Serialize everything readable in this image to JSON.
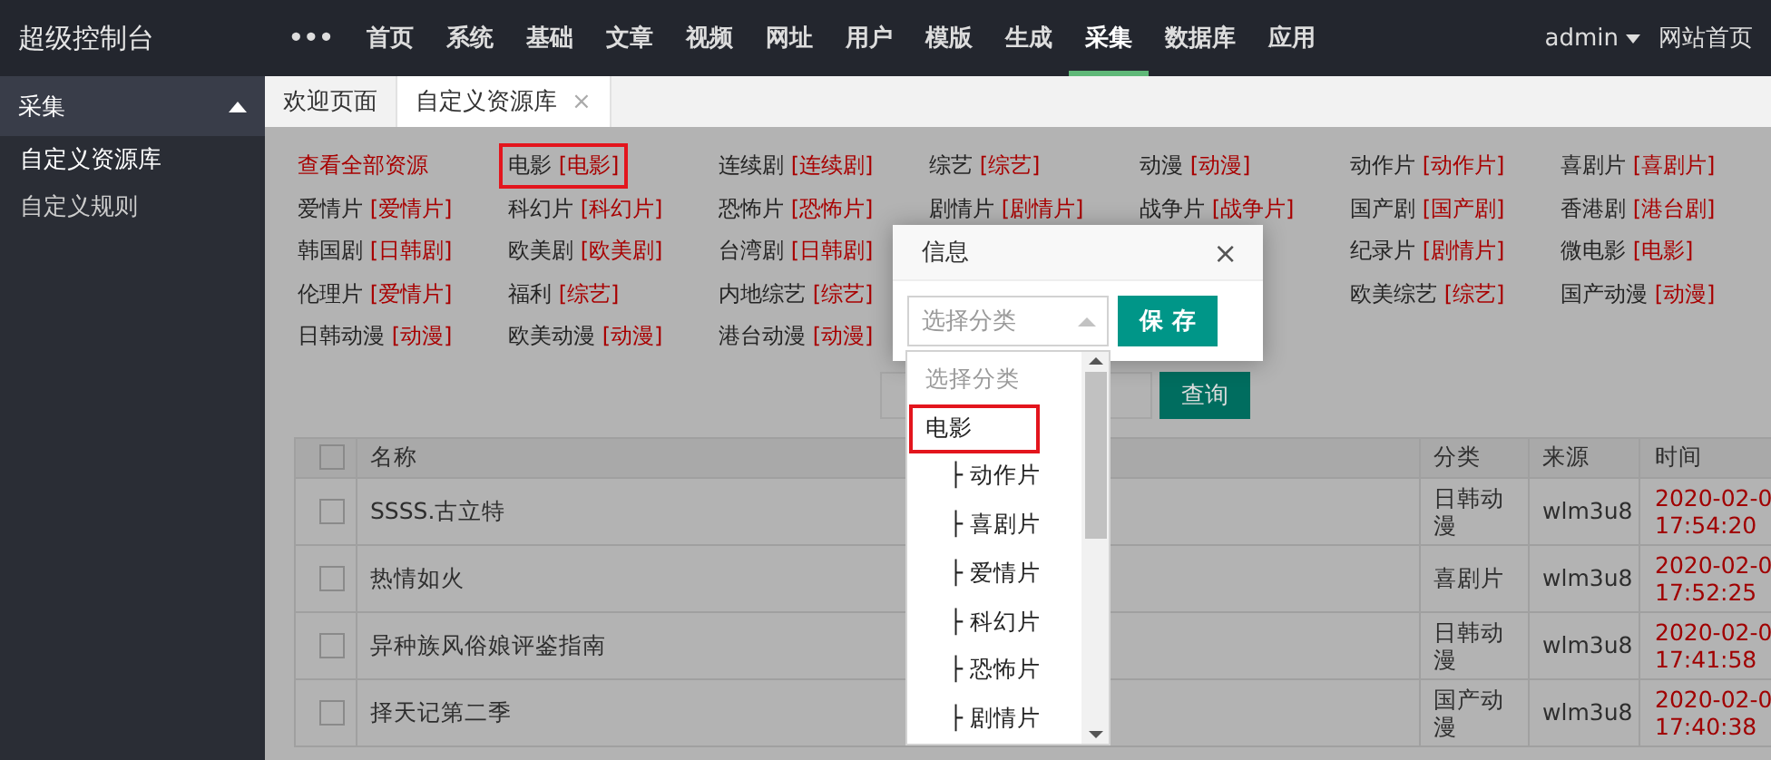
{
  "top_bar": {
    "logo": "超级控制台",
    "nav": [
      {
        "label": "•••",
        "selected": false
      },
      {
        "label": "首页",
        "selected": false
      },
      {
        "label": "系统",
        "selected": false
      },
      {
        "label": "基础",
        "selected": false
      },
      {
        "label": "文章",
        "selected": false
      },
      {
        "label": "视频",
        "selected": false
      },
      {
        "label": "网址",
        "selected": false
      },
      {
        "label": "用户",
        "selected": false
      },
      {
        "label": "模版",
        "selected": false
      },
      {
        "label": "生成",
        "selected": false
      },
      {
        "label": "采集",
        "selected": true
      },
      {
        "label": "数据库",
        "selected": false
      },
      {
        "label": "应用",
        "selected": false
      }
    ],
    "user": "admin",
    "site_link": "网站首页"
  },
  "sidebar": {
    "header": "采集",
    "expanded": true,
    "items": [
      {
        "label": "自定义资源库",
        "selected": true
      },
      {
        "label": "自定义规则",
        "selected": false
      }
    ]
  },
  "tabs": [
    {
      "label": "欢迎页面",
      "selected": false,
      "closable": false
    },
    {
      "label": "自定义资源库",
      "selected": true,
      "closable": true,
      "close": "×"
    }
  ],
  "category_links": [
    {
      "kind": "all",
      "name": "查看全部资源",
      "highlighted": false
    },
    {
      "kind": "mapped",
      "name": "电影",
      "target": "[电影]",
      "highlighted": true
    },
    {
      "kind": "mapped",
      "name": "连续剧",
      "target": "[连续剧]",
      "highlighted": false
    },
    {
      "kind": "mapped",
      "name": "综艺",
      "target": "[综艺]",
      "highlighted": false
    },
    {
      "kind": "mapped",
      "name": "动漫",
      "target": "[动漫]",
      "highlighted": false
    },
    {
      "kind": "mapped",
      "name": "动作片",
      "target": "[动作片]",
      "highlighted": false
    },
    {
      "kind": "mapped",
      "name": "喜剧片",
      "target": "[喜剧片]",
      "highlighted": false
    },
    {
      "kind": "mapped",
      "name": "爱情片",
      "target": "[爱情片]",
      "highlighted": false
    },
    {
      "kind": "mapped",
      "name": "科幻片",
      "target": "[科幻片]",
      "highlighted": false
    },
    {
      "kind": "mapped",
      "name": "恐怖片",
      "target": "[恐怖片]",
      "highlighted": false
    },
    {
      "kind": "mapped",
      "name": "剧情片",
      "target": "[剧情片]",
      "highlighted": false
    },
    {
      "kind": "mapped",
      "name": "战争片",
      "target": "[战争片]",
      "highlighted": false
    },
    {
      "kind": "mapped",
      "name": "国产剧",
      "target": "[国产剧]",
      "highlighted": false
    },
    {
      "kind": "mapped",
      "name": "香港剧",
      "target": "[港台剧]",
      "highlighted": false
    },
    {
      "kind": "mapped",
      "name": "韩国剧",
      "target": "[日韩剧]",
      "highlighted": false
    },
    {
      "kind": "mapped",
      "name": "欧美剧",
      "target": "[欧美剧]",
      "highlighted": false
    },
    {
      "kind": "mapped",
      "name": "台湾剧",
      "target": "[日韩剧]",
      "highlighted": false
    },
    {
      "kind": "mapped",
      "name": "纪录片",
      "target": "[剧情片]",
      "highlighted": false
    },
    {
      "kind": "mapped",
      "name": "微电影",
      "target": "[电影]",
      "highlighted": false
    },
    {
      "kind": "mapped",
      "name": "伦理片",
      "target": "[爱情片]",
      "highlighted": false
    },
    {
      "kind": "mapped",
      "name": "福利",
      "target": "[综艺]",
      "highlighted": false
    },
    {
      "kind": "mapped",
      "name": "内地综艺",
      "target": "[综艺]",
      "highlighted": false
    },
    {
      "kind": "mapped",
      "name": "欧美综艺",
      "target": "[综艺]",
      "highlighted": false
    },
    {
      "kind": "mapped",
      "name": "国产动漫",
      "target": "[动漫]",
      "highlighted": false
    },
    {
      "kind": "mapped",
      "name": "日韩动漫",
      "target": "[动漫]",
      "highlighted": false
    },
    {
      "kind": "mapped",
      "name": "欧美动漫",
      "target": "[动漫]",
      "highlighted": false
    },
    {
      "kind": "mapped",
      "name": "港台动漫",
      "target": "[动漫]",
      "highlighted": false
    }
  ],
  "search": {
    "button": "查询"
  },
  "table": {
    "select_all_checked": false,
    "columns": [
      "名称",
      "分类",
      "来源",
      "时间"
    ],
    "rows": [
      {
        "checked": false,
        "name": "SSSS.古立特",
        "category": "日韩动漫",
        "source": "wlm3u8",
        "date": "2020-02-0",
        "time": "17:54:20"
      },
      {
        "checked": false,
        "name": "热情如火",
        "category": "喜剧片",
        "source": "wlm3u8",
        "date": "2020-02-0",
        "time": "17:52:25"
      },
      {
        "checked": false,
        "name": "异种族风俗娘评鉴指南",
        "category": "日韩动漫",
        "source": "wlm3u8",
        "date": "2020-02-0",
        "time": "17:41:58"
      },
      {
        "checked": false,
        "name": "择天记第二季",
        "category": "国产动漫",
        "source": "wlm3u8",
        "date": "2020-02-0",
        "time": "17:40:38"
      }
    ]
  },
  "dialog": {
    "title": "信息",
    "close": "×",
    "select": {
      "placeholder": "选择分类",
      "expanded": true
    },
    "save": "保 存",
    "options": [
      {
        "kind": "placeholder",
        "label": "选择分类",
        "highlighted": false
      },
      {
        "kind": "option",
        "label": "电影",
        "highlighted": true
      },
      {
        "kind": "option",
        "label": "├ 动作片",
        "highlighted": false
      },
      {
        "kind": "option",
        "label": "├ 喜剧片",
        "highlighted": false
      },
      {
        "kind": "option",
        "label": "├ 爱情片",
        "highlighted": false
      },
      {
        "kind": "option",
        "label": "├ 科幻片",
        "highlighted": false
      },
      {
        "kind": "option",
        "label": "├ 恐怖片",
        "highlighted": false
      },
      {
        "kind": "option",
        "label": "├ 剧情片",
        "highlighted": false
      }
    ]
  }
}
